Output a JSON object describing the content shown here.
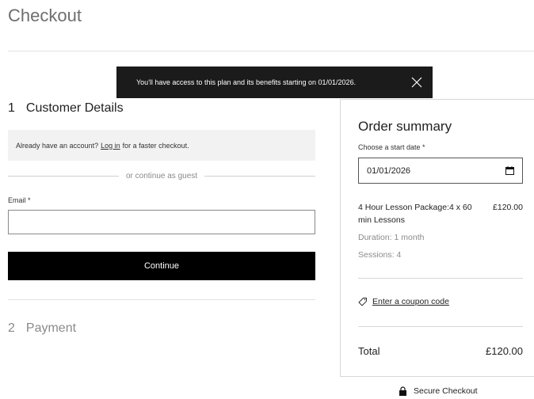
{
  "page": {
    "title": "Checkout"
  },
  "toast": {
    "message": "You'll have access to this plan and its benefits starting on 01/01/2026.",
    "close_icon": "close-icon"
  },
  "customer_details": {
    "number": "1",
    "title": "Customer Details",
    "login_prompt_before": "Already have an account?",
    "login_link": "Log in",
    "login_prompt_after": "for a faster checkout.",
    "guest_divider": "or continue as guest",
    "email_label": "Email *",
    "email_value": "",
    "continue_label": "Continue"
  },
  "payment": {
    "number": "2",
    "title": "Payment"
  },
  "order_summary": {
    "title": "Order summary",
    "start_date_label": "Choose a start date *",
    "start_date_value": "01/01/2026",
    "calendar_icon": "calendar-icon",
    "item_name": "4 Hour Lesson Package:4 x 60 min Lessons",
    "item_price": "£120.00",
    "item_duration": "Duration: 1 month",
    "item_sessions": "Sessions: 4",
    "coupon_icon": "tag-icon",
    "coupon_label": "Enter a coupon code",
    "total_label": "Total",
    "total_value": "£120.00"
  },
  "footer": {
    "lock_icon": "lock-icon",
    "secure_label": "Secure Checkout"
  }
}
